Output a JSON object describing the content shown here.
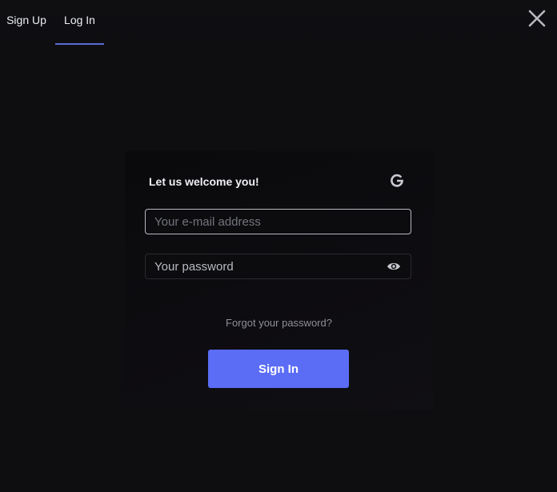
{
  "tabs": [
    {
      "label": "Sign Up",
      "active": false
    },
    {
      "label": "Log In",
      "active": true
    }
  ],
  "close_icon": "close-icon",
  "card": {
    "title": "Let us welcome you!",
    "google_icon": "google-icon",
    "email": {
      "value": "",
      "placeholder": "Your e-mail address"
    },
    "password": {
      "value": "",
      "placeholder": "Your password",
      "toggle_icon": "eye-icon"
    },
    "forgot_label": "Forgot your password?",
    "submit_label": "Sign In"
  },
  "colors": {
    "background": "#0e0e11",
    "accent": "#5b6cf5",
    "tab_underline": "#5869d6",
    "text": "#eef0f4",
    "muted_text": "#8e9097"
  }
}
